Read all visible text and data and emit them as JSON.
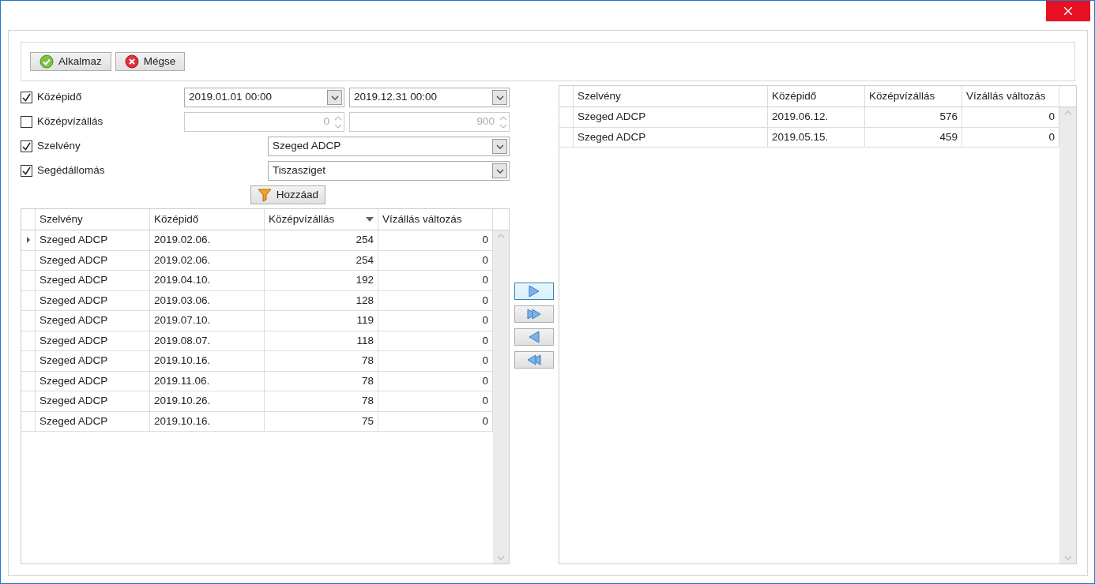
{
  "toolbar": {
    "buttons": [
      {
        "kind": "apply",
        "label": "Alkalmaz"
      },
      {
        "kind": "cancel",
        "label": "Mégse"
      }
    ]
  },
  "filters": [
    {
      "kind": "date_range",
      "label": "Középidő",
      "checked": true,
      "disabled": false,
      "from": "2019.01.01 00:00",
      "to": "2019.12.31 00:00"
    },
    {
      "kind": "number_range",
      "label": "Középvízállás",
      "checked": false,
      "disabled": true,
      "from": "0",
      "to": "900"
    },
    {
      "kind": "combo",
      "label": "Szelvény",
      "checked": true,
      "disabled": false,
      "value": "Szeged ADCP"
    },
    {
      "kind": "combo",
      "label": "Segédállomás",
      "checked": true,
      "disabled": false,
      "value": "Tiszasziget"
    }
  ],
  "add_button": {
    "label": "Hozzáad"
  },
  "left_grid": {
    "columns": [
      {
        "label": "Szelvény",
        "sorted_descending": false
      },
      {
        "label": "Középidő",
        "sorted_descending": false
      },
      {
        "label": "Középvízállás",
        "sorted_descending": true
      },
      {
        "label": "Vízállás változás",
        "sorted_descending": false
      }
    ],
    "rows": [
      {
        "selected": true,
        "cells": [
          "Szeged ADCP",
          "2019.02.06.",
          "254",
          "0"
        ]
      },
      {
        "selected": false,
        "cells": [
          "Szeged ADCP",
          "2019.02.06.",
          "254",
          "0"
        ]
      },
      {
        "selected": false,
        "cells": [
          "Szeged ADCP",
          "2019.04.10.",
          "192",
          "0"
        ]
      },
      {
        "selected": false,
        "cells": [
          "Szeged ADCP",
          "2019.03.06.",
          "128",
          "0"
        ]
      },
      {
        "selected": false,
        "cells": [
          "Szeged ADCP",
          "2019.07.10.",
          "119",
          "0"
        ]
      },
      {
        "selected": false,
        "cells": [
          "Szeged ADCP",
          "2019.08.07.",
          "118",
          "0"
        ]
      },
      {
        "selected": false,
        "cells": [
          "Szeged ADCP",
          "2019.10.16.",
          "78",
          "0"
        ]
      },
      {
        "selected": false,
        "cells": [
          "Szeged ADCP",
          "2019.11.06.",
          "78",
          "0"
        ]
      },
      {
        "selected": false,
        "cells": [
          "Szeged ADCP",
          "2019.10.26.",
          "78",
          "0"
        ]
      },
      {
        "selected": false,
        "cells": [
          "Szeged ADCP",
          "2019.10.16.",
          "75",
          "0"
        ]
      }
    ]
  },
  "transfer_buttons": [
    {
      "kind": "move_right",
      "focused": true
    },
    {
      "kind": "move_all_right",
      "focused": false
    },
    {
      "kind": "move_left",
      "focused": false
    },
    {
      "kind": "move_all_left",
      "focused": false
    }
  ],
  "right_grid": {
    "columns": [
      {
        "label": "Szelvény",
        "sorted_descending": false
      },
      {
        "label": "Középidő",
        "sorted_descending": false
      },
      {
        "label": "Középvízállás",
        "sorted_descending": false
      },
      {
        "label": "Vízállás változás",
        "sorted_descending": false
      }
    ],
    "rows": [
      {
        "selected": false,
        "cells": [
          "Szeged ADCP",
          "2019.06.12.",
          "576",
          "0"
        ]
      },
      {
        "selected": false,
        "cells": [
          "Szeged ADCP",
          "2019.05.15.",
          "459",
          "0"
        ]
      }
    ]
  }
}
